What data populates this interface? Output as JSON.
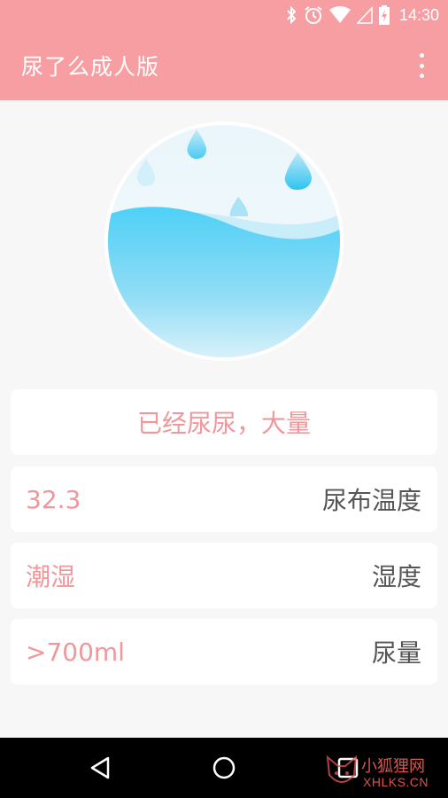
{
  "status_bar": {
    "time": "14:30",
    "icons": [
      "bluetooth-icon",
      "alarm-icon",
      "wifi-icon",
      "signal-icon",
      "battery-charging-icon"
    ]
  },
  "app_bar": {
    "title": "尿了么成人版",
    "menu_icon": "overflow-menu-icon"
  },
  "status_card": {
    "text": "已经尿尿，大量"
  },
  "readings": [
    {
      "value": "32.3",
      "label": "尿布温度"
    },
    {
      "value": "潮湿",
      "label": "湿度"
    },
    {
      "value": ">700ml",
      "label": "尿量"
    }
  ],
  "nav_bar": {
    "icons": [
      "back-icon",
      "home-icon",
      "recent-apps-icon"
    ]
  },
  "watermark": {
    "text_cn": "小狐狸网",
    "text_en": "XHLKS.CN"
  },
  "colors": {
    "accent": "#f79ea2",
    "value_text": "#f1979b",
    "label_text": "#555555",
    "water": "#4fd0f7"
  }
}
